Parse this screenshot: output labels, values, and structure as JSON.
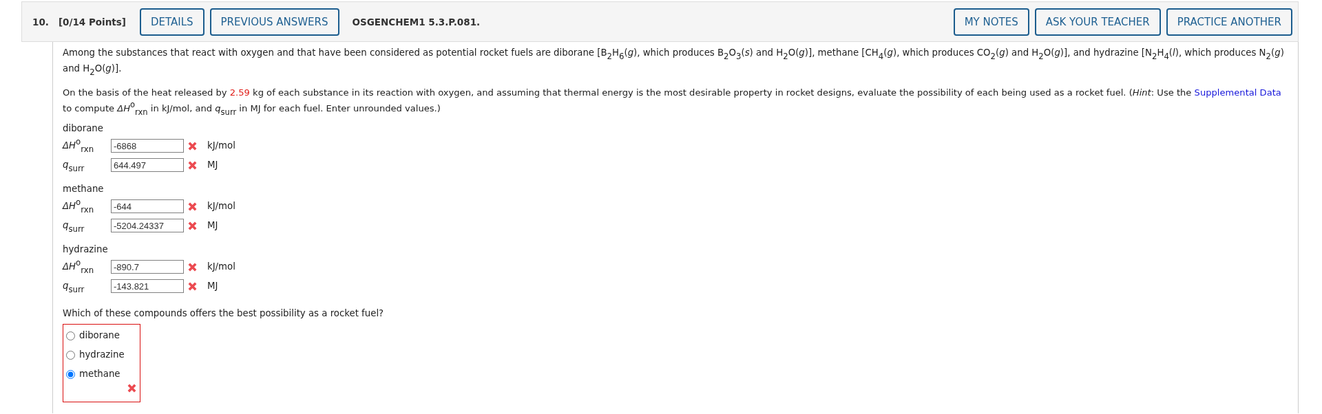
{
  "question": {
    "number": "10.",
    "points": "[0/14 Points]",
    "code": "OSGENCHEM1 5.3.P.081."
  },
  "header_buttons_left": [
    "DETAILS",
    "PREVIOUS ANSWERS"
  ],
  "header_buttons_right": [
    "MY NOTES",
    "ASK YOUR TEACHER",
    "PRACTICE ANOTHER"
  ],
  "intro": "Among the substances that react with oxygen and that have been considered as potential rocket fuels are diborane [B$_{2}$H$_{6}$(*g*), which produces B$_{2}$O$_{3}$(*s*) and H$_{2}$O(*g*)], methane [CH$_{4}$(*g*), which produces CO$_{2}$(*g*) and H$_{2}$O(*g*)], and hydrazine [N$_{2}$H$_{4}$(*l*), which produces N$_{2}$(*g*) and H$_{2}$O(*g*)].",
  "instructions": [
    {
      "kind": "text",
      "text": "On the basis of the heat released by "
    },
    {
      "kind": "value",
      "text": "2.59"
    },
    {
      "kind": "text",
      "text": " kg of each substance in its reaction with oxygen, and assuming that thermal energy is the most desirable property in rocket designs, evaluate the possibility of each being used as a rocket fuel. (*Hint*: Use the "
    },
    {
      "kind": "link",
      "text": "Supplemental Data"
    },
    {
      "kind": "text",
      "text": " to compute *ΔH*$^{o}$$_{rxn}$ in kJ/mol, and *q*$_{surr}$ in MJ for each fuel. Enter unrounded values.)"
    }
  ],
  "substances": [
    {
      "name": "diborane",
      "rows": [
        {
          "label": "*ΔH*$^{o}$$_{rxn}$",
          "value": "-6868",
          "correct": false,
          "unit": "kJ/mol"
        },
        {
          "label": "*q*$_{surr}$",
          "value": "644.497",
          "correct": false,
          "unit": "MJ"
        }
      ]
    },
    {
      "name": "methane",
      "rows": [
        {
          "label": "*ΔH*$^{o}$$_{rxn}$",
          "value": "-644",
          "correct": false,
          "unit": "kJ/mol"
        },
        {
          "label": "*q*$_{surr}$",
          "value": "-5204.24337",
          "correct": false,
          "unit": "MJ"
        }
      ]
    },
    {
      "name": "hydrazine",
      "rows": [
        {
          "label": "*ΔH*$^{o}$$_{rxn}$",
          "value": "-890.7",
          "correct": false,
          "unit": "kJ/mol"
        },
        {
          "label": "*q*$_{surr}$",
          "value": "-143.821",
          "correct": false,
          "unit": "MJ"
        }
      ]
    }
  ],
  "choice": {
    "prompt": "Which of these compounds offers the best possibility as a rocket fuel?",
    "correct": false,
    "options": [
      {
        "label": "diborane",
        "selected": false
      },
      {
        "label": "hydrazine",
        "selected": false
      },
      {
        "label": "methane",
        "selected": true
      }
    ]
  }
}
